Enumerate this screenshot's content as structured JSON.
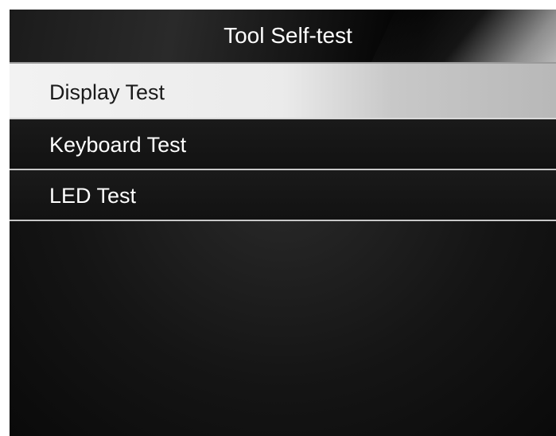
{
  "title": "Tool Self-test",
  "menu": {
    "items": [
      {
        "label": "Display Test",
        "selected": true
      },
      {
        "label": "Keyboard Test",
        "selected": false
      },
      {
        "label": "LED Test",
        "selected": false
      }
    ]
  }
}
